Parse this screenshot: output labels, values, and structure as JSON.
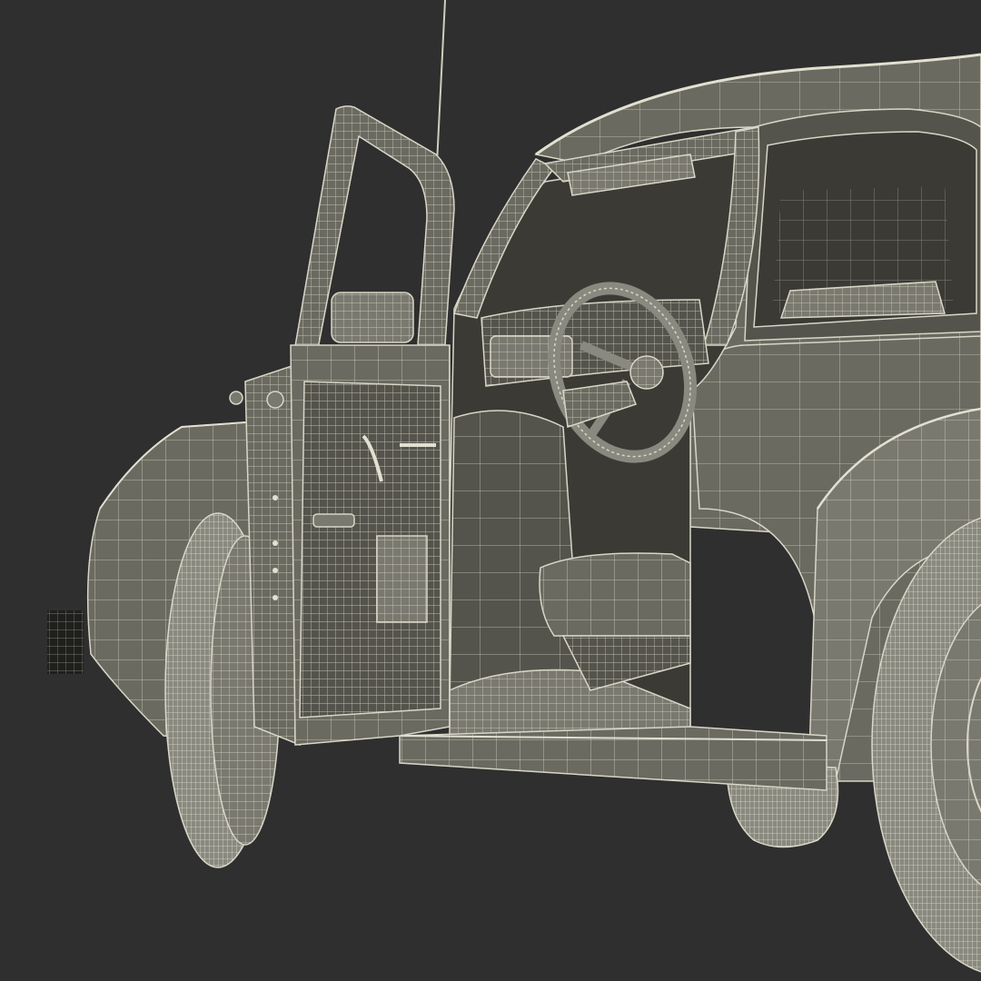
{
  "scene": {
    "subject": "car-wireframe-render",
    "colors": {
      "background": "#2f2f2f",
      "body": "#6b6a61",
      "body_dark": "#55544c",
      "body_light": "#7a796f",
      "interior": "#3b3a35",
      "tire": "#8a897f",
      "wire": "#d8d6c6"
    }
  }
}
